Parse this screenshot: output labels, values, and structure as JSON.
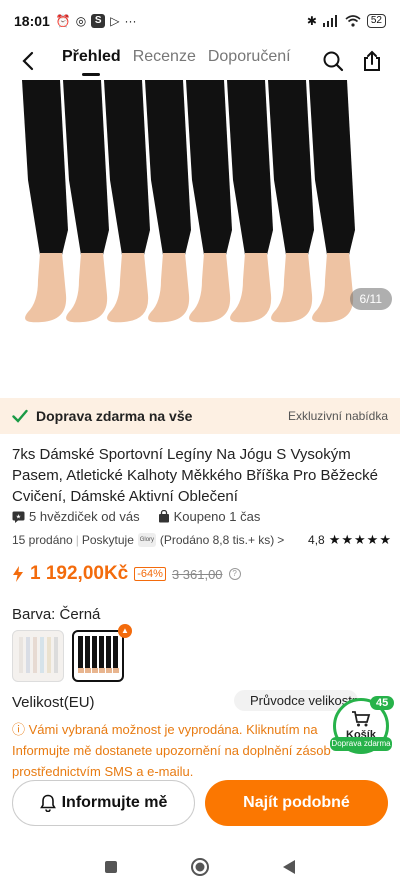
{
  "status": {
    "time": "18:01",
    "battery": "52",
    "icons": [
      "alarm-icon",
      "vpn-icon",
      "s-app-icon",
      "play-icon",
      "more-dots-icon"
    ]
  },
  "nav": {
    "tabs": [
      {
        "label": "Přehled",
        "active": true
      },
      {
        "label": "Recenze",
        "active": false
      },
      {
        "label": "Doporučení",
        "active": false
      }
    ]
  },
  "gallery": {
    "counter": "6/11"
  },
  "shipping": {
    "label": "Doprava zdarma na vše",
    "badge": "Exkluzivní nabídka"
  },
  "product": {
    "title": "7ks Dámské Sportovní Legíny Na Jógu S Vysokým Pasem, Atletické Kalhoty Měkkého Bříška Pro Běžecké Cvičení, Dámské Aktivní Oblečení",
    "reviews": "5 hvězdiček od vás",
    "bought": "Koupeno 1 čas",
    "sold": "15 prodáno",
    "provider_label": "Poskytuje",
    "seller_sold": "(Prodáno 8,8 tis.+ ks)",
    "chev": ">",
    "rating": "4,8",
    "stars": "★★★★★",
    "price": "1 192,00Kč",
    "discount": "-64%",
    "old_price": "3 361,00",
    "info_mark": "?"
  },
  "variant": {
    "color_label": "Barva: Černá",
    "size_label": "Velikost(EU)",
    "size_guide": "Průvodce velikostmi"
  },
  "notice": {
    "text": "ⓘ Vámi vybraná možnost je vyprodána. Kliknutím na Informujte mě dostanete upozornění na doplnění zásob prostřednictvím SMS a e-mailu."
  },
  "cart": {
    "label": "Košík",
    "count": "45",
    "shipping": "Doprava zdarma"
  },
  "actions": {
    "notify": "Informujte mě",
    "similar": "Najít podobné"
  },
  "colors": {
    "accent": "#fb7701",
    "cart_green": "#27b24a",
    "ship_bg": "#fdf0e3"
  }
}
